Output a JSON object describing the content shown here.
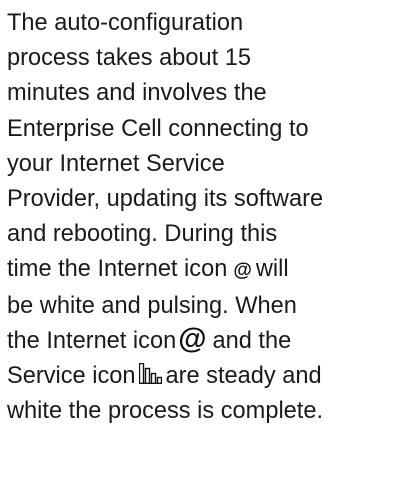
{
  "lines": [
    "The auto-configuration",
    "process takes about 15",
    "minutes and involves the",
    "Enterprise Cell connecting to",
    "your Internet Service",
    "Provider, updating its software",
    "and rebooting. During this"
  ],
  "line8": {
    "before": "time the Internet icon",
    "icon": "internet-icon",
    "after": "will"
  },
  "line9": "be white and pulsing. When",
  "line10": {
    "before": "the Internet icon",
    "icon": "internet-icon",
    "after": "and the"
  },
  "line11": {
    "before": "Service icon",
    "icon": "service-icon",
    "after": "are steady and"
  },
  "line12": "white the process is complete."
}
